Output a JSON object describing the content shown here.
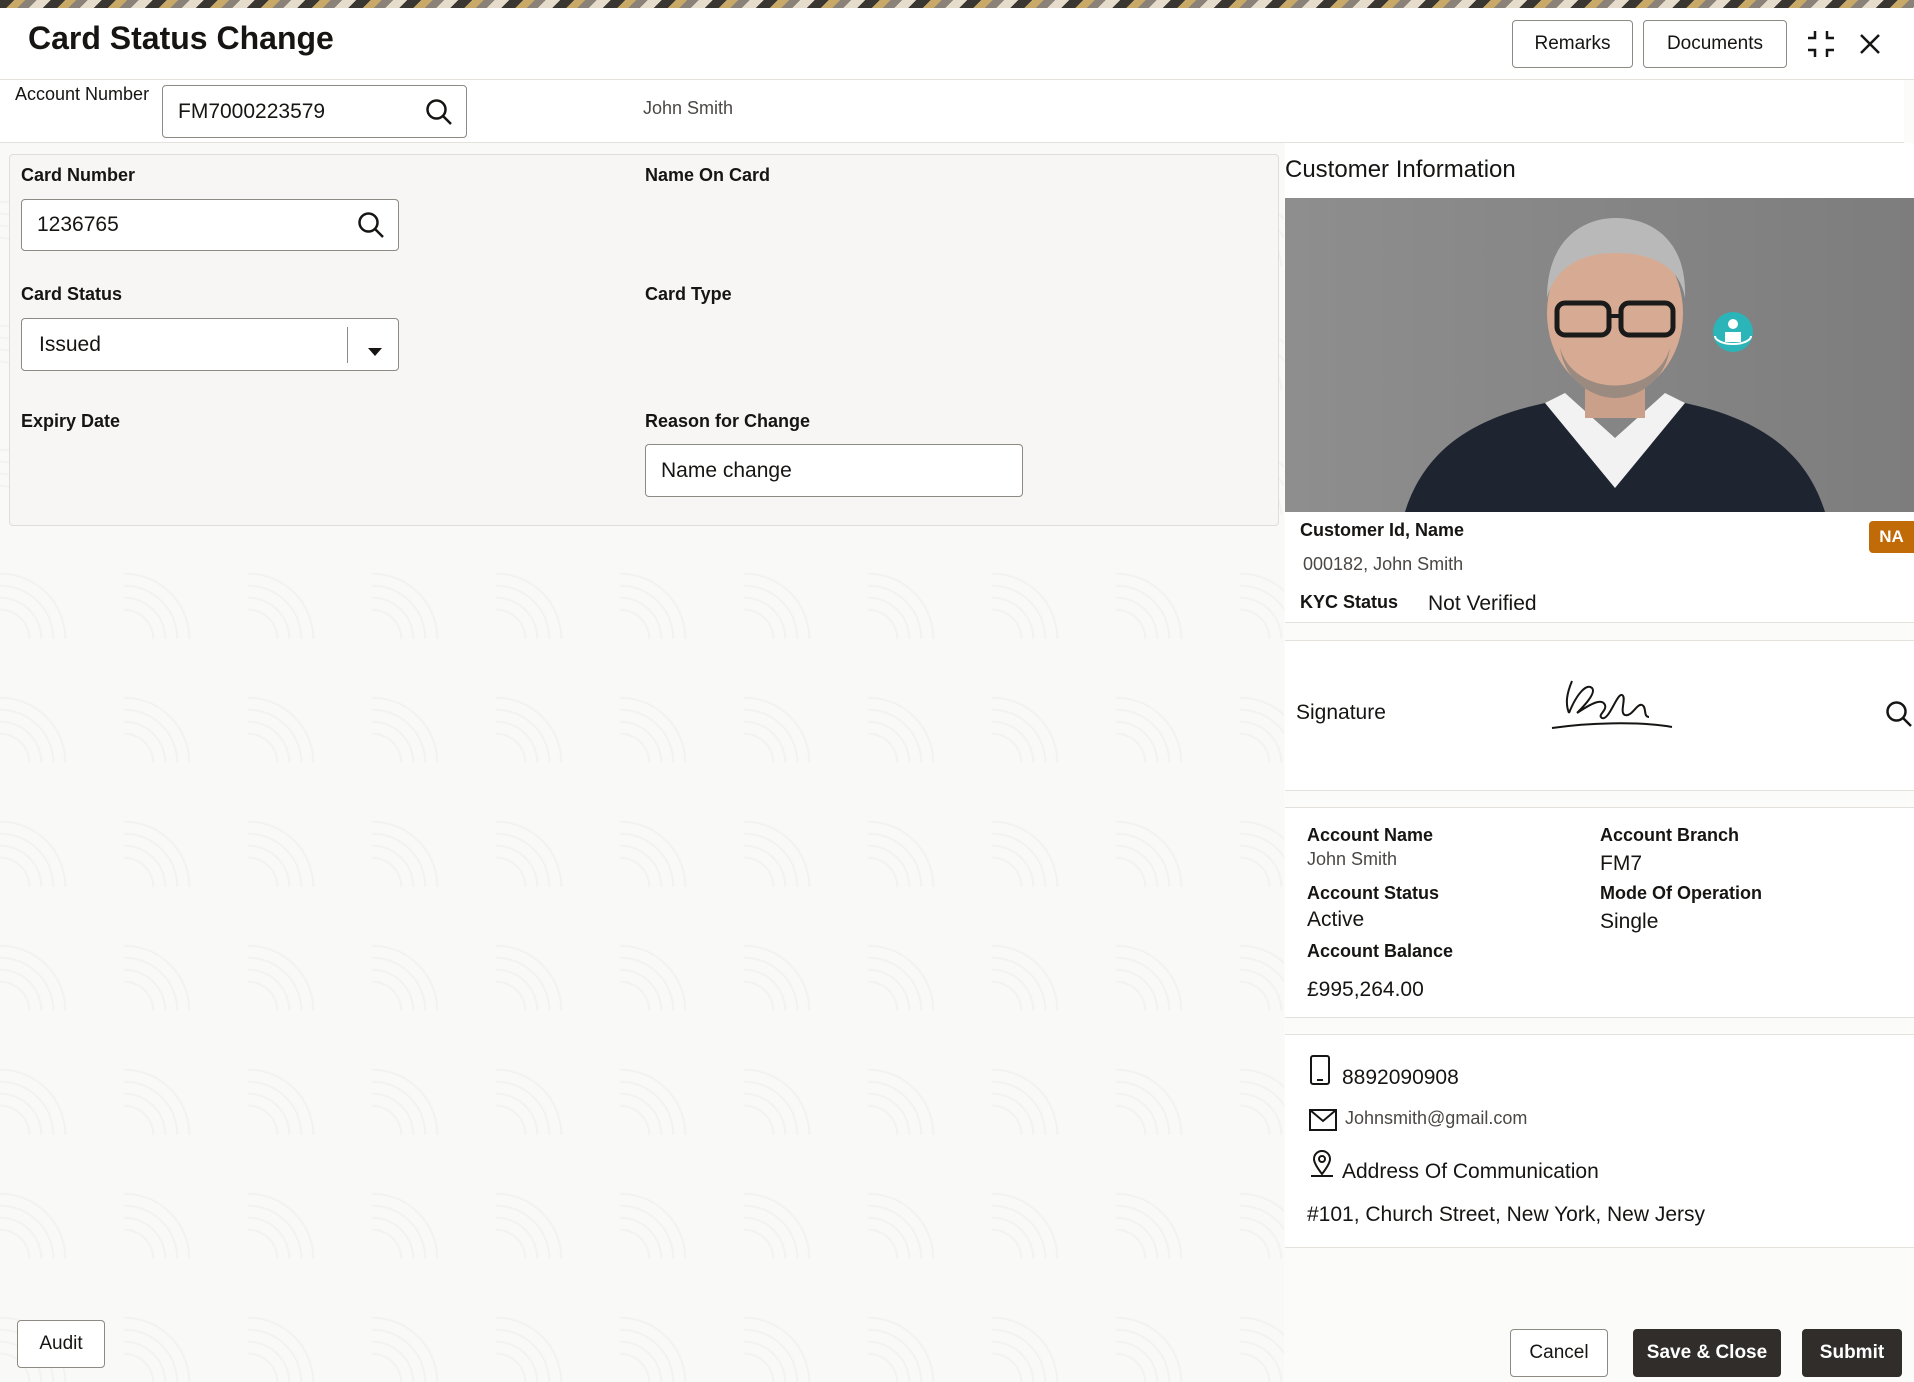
{
  "header": {
    "title": "Card Status Change",
    "remarks_label": "Remarks",
    "documents_label": "Documents"
  },
  "account": {
    "label": "Account Number",
    "value": "FM7000223579",
    "holder_name": "John Smith"
  },
  "form": {
    "card_number_label": "Card Number",
    "card_number_value": "1236765",
    "name_on_card_label": "Name On Card",
    "card_status_label": "Card Status",
    "card_status_value": "Issued",
    "card_type_label": "Card Type",
    "expiry_date_label": "Expiry Date",
    "reason_label": "Reason for Change",
    "reason_value": "Name change"
  },
  "customer": {
    "section_title": "Customer Information",
    "id_name_label": "Customer Id, Name",
    "id_name_value": "000182, John Smith",
    "badge": "NA",
    "kyc_label": "KYC Status",
    "kyc_value": "Not Verified",
    "signature_label": "Signature"
  },
  "account_details": {
    "name_label": "Account Name",
    "name_value": "John Smith",
    "branch_label": "Account Branch",
    "branch_value": "FM7",
    "status_label": "Account Status",
    "status_value": "Active",
    "mode_label": "Mode Of Operation",
    "mode_value": "Single",
    "balance_label": "Account Balance",
    "balance_value": "£995,264.00"
  },
  "contact": {
    "phone": "8892090908",
    "email": "Johnsmith@gmail.com",
    "address_label": "Address Of Communication",
    "address_value": "#101, Church Street, New York, New Jersy"
  },
  "footer": {
    "audit_label": "Audit",
    "cancel_label": "Cancel",
    "save_close_label": "Save & Close",
    "submit_label": "Submit"
  },
  "colors": {
    "primary_dark": "#312d2a",
    "badge": "#c16a08",
    "accent_teal": "#2bb5b8"
  }
}
